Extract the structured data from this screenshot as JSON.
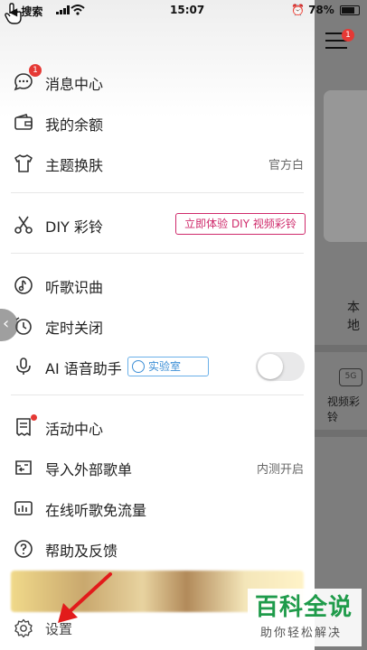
{
  "status_bar": {
    "back_label": "◀ 搜索",
    "time": "15:07",
    "battery": "78%"
  },
  "drawer": {
    "menu": [
      {
        "label": "消息中心",
        "badge": "1"
      },
      {
        "label": "我的余额"
      },
      {
        "label": "主题换肤",
        "value": "官方白"
      },
      {
        "label": "DIY 彩铃",
        "tag": "立即体验 DIY 视频彩铃"
      },
      {
        "label": "听歌识曲"
      },
      {
        "label": "定时关闭"
      },
      {
        "label": "AI 语音助手",
        "tag": "实验室",
        "toggle_on": false
      },
      {
        "label": "活动中心"
      },
      {
        "label": "导入外部歌单",
        "value": "内测开启"
      },
      {
        "label": "在线听歌免流量"
      },
      {
        "label": "帮助及反馈"
      }
    ],
    "settings_label": "设置"
  },
  "background": {
    "menu_badge": "1",
    "local_label": "本地",
    "video_label": "视频彩铃",
    "fiveg_label": "5G"
  },
  "watermark": {
    "title": "百科全说",
    "subtitle": "助你轻松解决"
  },
  "colors": {
    "badge_red": "#e53935",
    "diy_pink": "#cf2a6b",
    "lab_blue": "#3d8fd6",
    "watermark_green": "#1f9b4a"
  }
}
